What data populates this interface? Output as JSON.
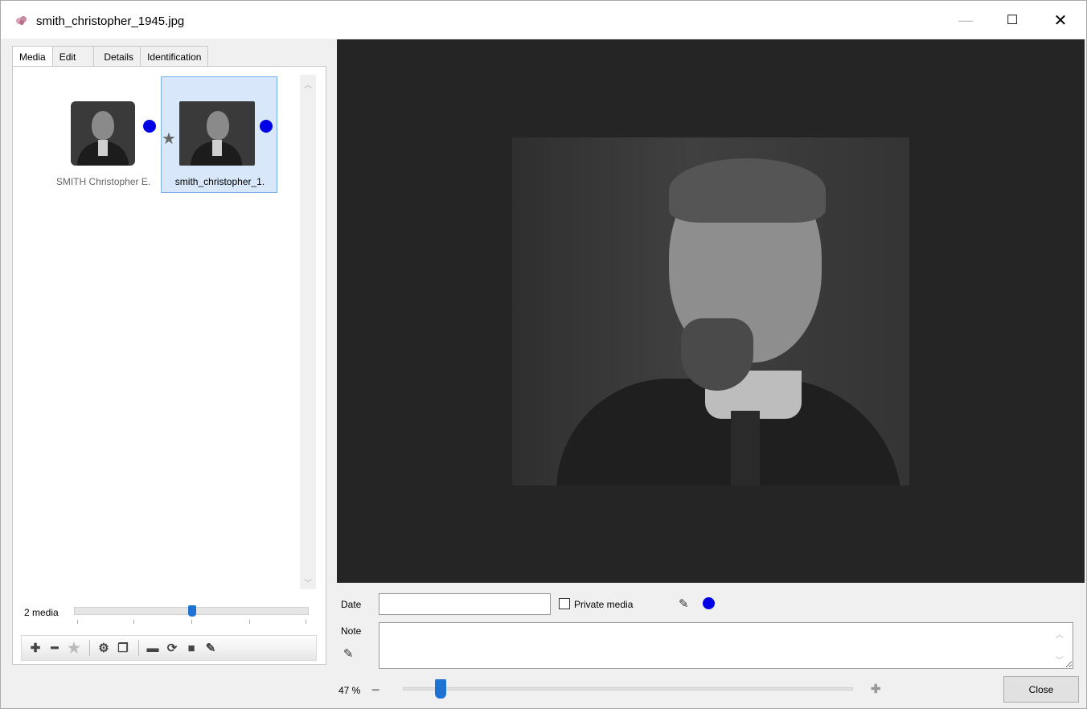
{
  "window": {
    "title": "smith_christopher_1945.jpg",
    "minimize": "—",
    "maximize": "☐",
    "close": "✕"
  },
  "tabs": [
    {
      "label": "Media"
    },
    {
      "label": "Edit"
    },
    {
      "label": "Details"
    },
    {
      "label": "Identification"
    }
  ],
  "media": {
    "items": [
      {
        "label": "SMITH Christopher E.",
        "starred": false,
        "status_color": "#0000e6"
      },
      {
        "label": "smith_christopher_1.",
        "starred": true,
        "status_color": "#0000e6"
      }
    ],
    "count_label": "2 media",
    "size_level_percent": 50
  },
  "toolbar": {
    "icons": [
      "add-icon",
      "remove-icon",
      "star-icon",
      "settings-icon",
      "gallery-icon",
      "folder-icon",
      "refresh-icon",
      "save-icon",
      "edit-icon"
    ],
    "add": "✚",
    "remove": "━",
    "star": "★",
    "settings": "⚙",
    "gallery": "❐",
    "folder": "▬",
    "refresh": "⟳",
    "save": "■",
    "edit": "✎"
  },
  "fields": {
    "date_label": "Date",
    "date_value": "",
    "private_label": "Private media",
    "private_checked": false,
    "pencil": "✎",
    "status_color": "#0000e6",
    "note_label": "Note",
    "note_value": ""
  },
  "zoom": {
    "label": "47 %",
    "minus": "━",
    "plus": "✚",
    "value_percent": 47
  },
  "buttons": {
    "close": "Close"
  }
}
